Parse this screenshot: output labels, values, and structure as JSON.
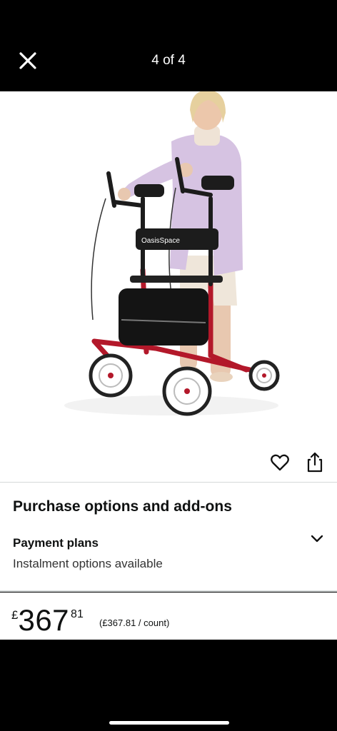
{
  "header": {
    "counter": "4 of 4",
    "close_icon": "close-icon"
  },
  "gallery": {
    "image_alt": "OasisSpace upright rollator walker",
    "brand_on_product": "OasisSpace",
    "dot_count": 5,
    "active_dot": 0,
    "heart_icon": "heart-outline-icon",
    "share_icon": "share-icon"
  },
  "purchase": {
    "title": "Purchase options and add-ons",
    "payment_plans": {
      "title": "Payment plans",
      "subtitle": "Instalment options available",
      "chevron_icon": "chevron-down-icon"
    }
  },
  "price": {
    "symbol": "£",
    "whole": "367",
    "fraction": "81",
    "unit_price": "(£367.81 / count)"
  },
  "colors": {
    "frame_red": "#b3182a",
    "divider": "#d5d9d9"
  }
}
